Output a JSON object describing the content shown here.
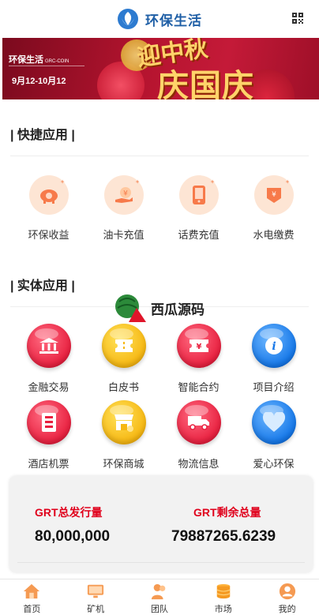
{
  "header": {
    "title": "环保生活"
  },
  "banner": {
    "brand": "环保生活",
    "brand_sub": "GRC-COIN",
    "date_range": "9月12-10月12",
    "headline_1": "迎中秋",
    "headline_2": "庆国庆"
  },
  "quick": {
    "title": "| 快捷应用 |",
    "items": [
      {
        "label": "环保收益",
        "icon": "piggy-bank-icon"
      },
      {
        "label": "油卡充值",
        "icon": "hand-coin-icon"
      },
      {
        "label": "话费充值",
        "icon": "phone-icon"
      },
      {
        "label": "水电缴费",
        "icon": "bill-icon"
      }
    ]
  },
  "entity": {
    "title": "| 实体应用 |",
    "row1": [
      {
        "label": "金融交易",
        "icon": "bank-icon",
        "color": "#e8203f"
      },
      {
        "label": "白皮书",
        "icon": "ticket-icon",
        "color": "#f6b712"
      },
      {
        "label": "智能合约",
        "icon": "contract-icon",
        "color": "#e8203f"
      },
      {
        "label": "项目介绍",
        "icon": "info-icon",
        "color": "#1577e8"
      }
    ],
    "row2": [
      {
        "label": "酒店机票",
        "icon": "hotel-icon",
        "color": "#e8203f"
      },
      {
        "label": "环保商城",
        "icon": "shop-icon",
        "color": "#f6b712"
      },
      {
        "label": "物流信息",
        "icon": "truck-icon",
        "color": "#e8203f"
      },
      {
        "label": "爱心环保",
        "icon": "heart-icon",
        "color": "#1577e8"
      }
    ]
  },
  "watermark": {
    "text": "西瓜源码"
  },
  "stats": {
    "issued_label": "GRT总发行量",
    "issued_value": "80,000,000",
    "remaining_label": "GRT剩余总量",
    "remaining_value": "79887265.6239"
  },
  "nav": {
    "items": [
      {
        "label": "首页",
        "icon": "home-icon"
      },
      {
        "label": "矿机",
        "icon": "monitor-icon"
      },
      {
        "label": "团队",
        "icon": "team-icon"
      },
      {
        "label": "市场",
        "icon": "coins-icon"
      },
      {
        "label": "我的",
        "icon": "user-icon"
      }
    ]
  },
  "colors": {
    "brand": "#1f5fa6",
    "accent_red": "#e0001b",
    "icon_red": "#e8203f",
    "icon_yellow": "#f6b712",
    "icon_blue": "#1577e8"
  }
}
